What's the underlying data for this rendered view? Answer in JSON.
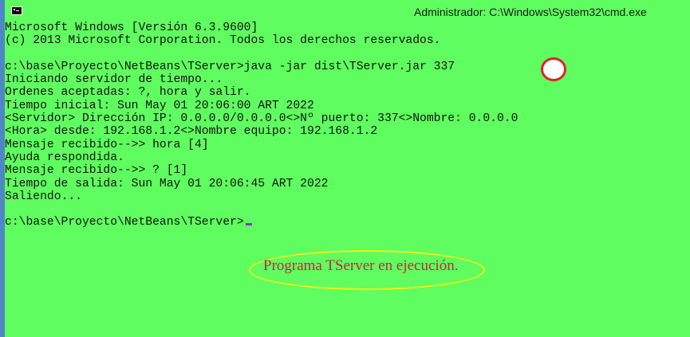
{
  "window": {
    "title": "Administrador: C:\\Windows\\System32\\cmd.exe",
    "icon": "cmd-icon"
  },
  "console": {
    "lines": [
      "Microsoft Windows [Versión 6.3.9600]",
      "(c) 2013 Microsoft Corporation. Todos los derechos reservados.",
      "",
      "c:\\base\\Proyecto\\NetBeans\\TServer>java -jar dist\\TServer.jar 337",
      "Iniciando servidor de tiempo...",
      "Ordenes aceptadas: ?, hora y salir.",
      "Tiempo inicial: Sun May 01 20:06:00 ART 2022",
      "<Servidor> Dirección IP: 0.0.0.0/0.0.0.0<>Nº puerto: 337<>Nombre: 0.0.0.0",
      "<Hora> desde: 192.168.1.2<>Nombre equipo: 192.168.1.2",
      "Mensaje recibido-->> hora [4]",
      "Ayuda respondida.",
      "Mensaje recibido-->> ? [1]",
      "Tiempo de salida: Sun May 01 20:06:45 ART 2022",
      "Saliendo...",
      "",
      "c:\\base\\Proyecto\\NetBeans\\TServer>"
    ]
  },
  "annotation": {
    "text": "Programa TServer en ejecución."
  },
  "colors": {
    "background": "#5ffd5f",
    "text": "#111111",
    "cursor": "#8f2fd3",
    "circle": "#e32028",
    "annotation_border": "#f2ef17",
    "annotation_text": "#d0223a"
  }
}
